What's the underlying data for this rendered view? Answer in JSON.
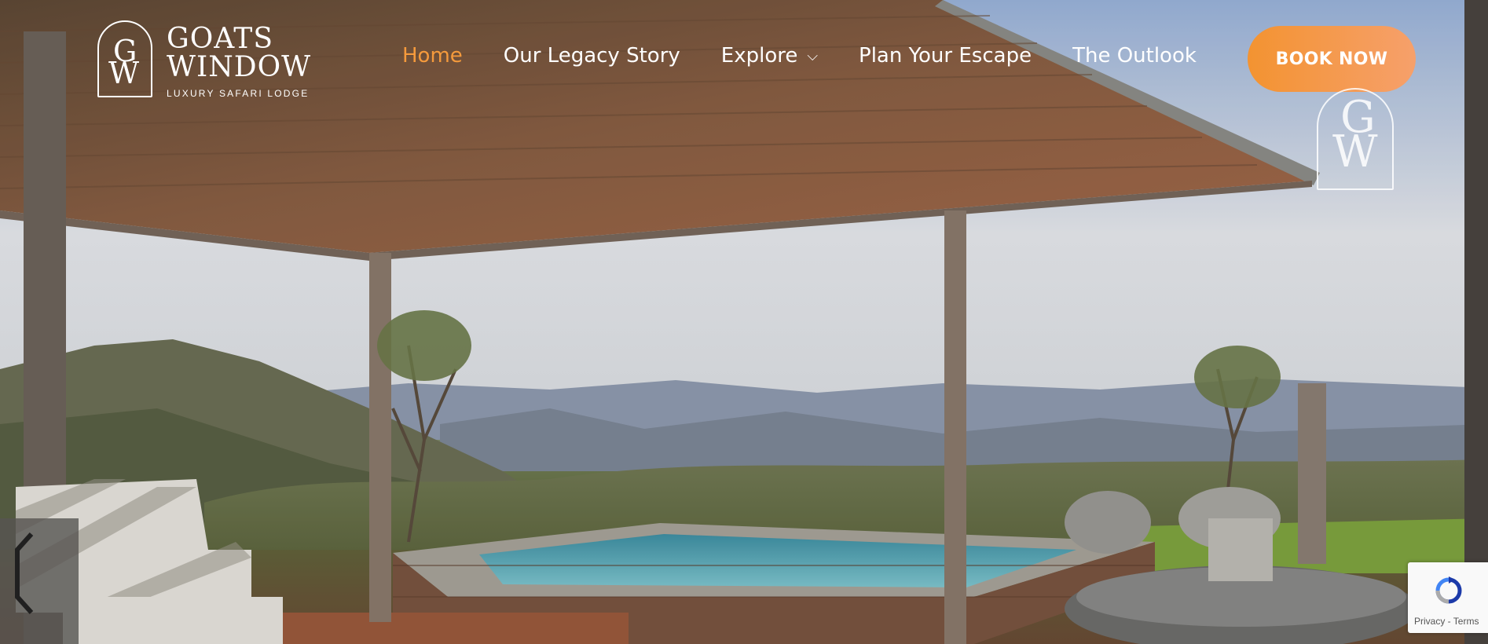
{
  "brand": {
    "name_line1": "GOATS",
    "name_line2": "WINDOW",
    "tagline": "LUXURY SAFARI LODGE",
    "monogram_top": "G",
    "monogram_bottom": "W"
  },
  "nav": {
    "items": [
      {
        "label": "Home",
        "active": true
      },
      {
        "label": "Our Legacy Story",
        "active": false
      },
      {
        "label": "Explore",
        "active": false,
        "has_dropdown": true
      },
      {
        "label": "Plan Your Escape",
        "active": false
      },
      {
        "label": "The Outlook",
        "active": false
      }
    ],
    "dropdown_icon": "chevron-down-icon",
    "active_color": "#f59a3c"
  },
  "cta": {
    "label": "BOOK NOW",
    "gradient_from": "#f39331",
    "gradient_to": "#f6a06b"
  },
  "hero": {
    "image_description_icon": "hero-video-frame"
  },
  "recaptcha": {
    "privacy": "Privacy",
    "separator": " - ",
    "terms": "Terms"
  }
}
